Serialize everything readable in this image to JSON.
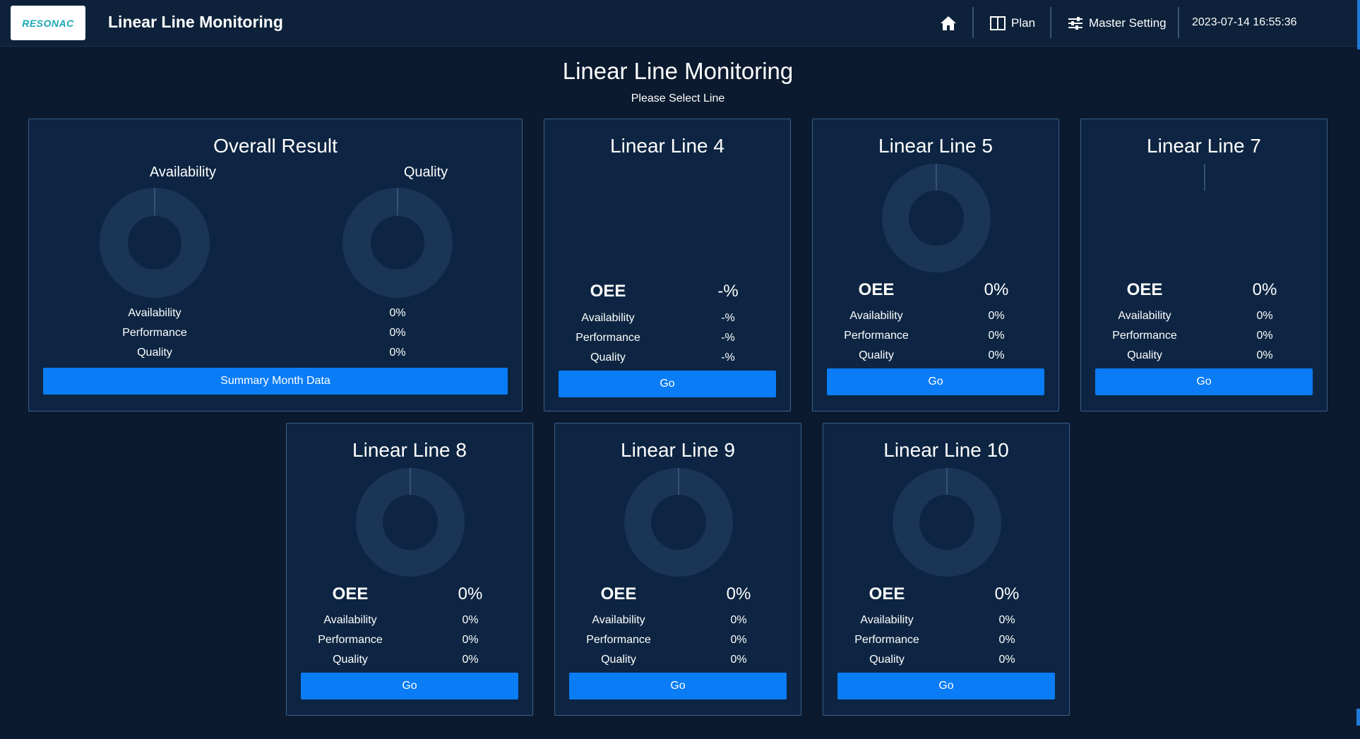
{
  "header": {
    "logo": "RESONAC",
    "title": "Linear Line Monitoring",
    "nav": {
      "home_icon": "home-icon",
      "plan": "Plan",
      "master_setting": "Master Setting"
    },
    "datetime": "2023-07-14 16:55:36"
  },
  "page": {
    "title": "Linear Line Monitoring",
    "subtitle": "Please Select Line"
  },
  "overall": {
    "title": "Overall Result",
    "chart_titles": [
      "Availability",
      "Quality"
    ],
    "metrics": [
      {
        "label": "Availability",
        "value": "0%"
      },
      {
        "label": "Performance",
        "value": "0%"
      },
      {
        "label": "Quality",
        "value": "0%"
      }
    ],
    "button": "Summary Month Data"
  },
  "lines": [
    {
      "title": "Linear Line 4",
      "oee_label": "OEE",
      "oee": "-%",
      "metrics": [
        {
          "label": "Availability",
          "value": "-%"
        },
        {
          "label": "Performance",
          "value": "-%"
        },
        {
          "label": "Quality",
          "value": "-%"
        }
      ],
      "button": "Go"
    },
    {
      "title": "Linear Line 5",
      "oee_label": "OEE",
      "oee": "0%",
      "metrics": [
        {
          "label": "Availability",
          "value": "0%"
        },
        {
          "label": "Performance",
          "value": "0%"
        },
        {
          "label": "Quality",
          "value": "0%"
        }
      ],
      "button": "Go"
    },
    {
      "title": "Linear Line 7",
      "oee_label": "OEE",
      "oee": "0%",
      "metrics": [
        {
          "label": "Availability",
          "value": "0%"
        },
        {
          "label": "Performance",
          "value": "0%"
        },
        {
          "label": "Quality",
          "value": "0%"
        }
      ],
      "button": "Go"
    },
    {
      "title": "Linear Line 8",
      "oee_label": "OEE",
      "oee": "0%",
      "metrics": [
        {
          "label": "Availability",
          "value": "0%"
        },
        {
          "label": "Performance",
          "value": "0%"
        },
        {
          "label": "Quality",
          "value": "0%"
        }
      ],
      "button": "Go"
    },
    {
      "title": "Linear Line 9",
      "oee_label": "OEE",
      "oee": "0%",
      "metrics": [
        {
          "label": "Availability",
          "value": "0%"
        },
        {
          "label": "Performance",
          "value": "0%"
        },
        {
          "label": "Quality",
          "value": "0%"
        }
      ],
      "button": "Go"
    },
    {
      "title": "Linear Line 10",
      "oee_label": "OEE",
      "oee": "0%",
      "metrics": [
        {
          "label": "Availability",
          "value": "0%"
        },
        {
          "label": "Performance",
          "value": "0%"
        },
        {
          "label": "Quality",
          "value": "0%"
        }
      ],
      "button": "Go"
    }
  ],
  "colors": {
    "background": "#0b1a2e",
    "card": "#0d2542",
    "border": "#3a5f8a",
    "button": "#0a7cf5",
    "donut_ring": "#1b3556"
  }
}
